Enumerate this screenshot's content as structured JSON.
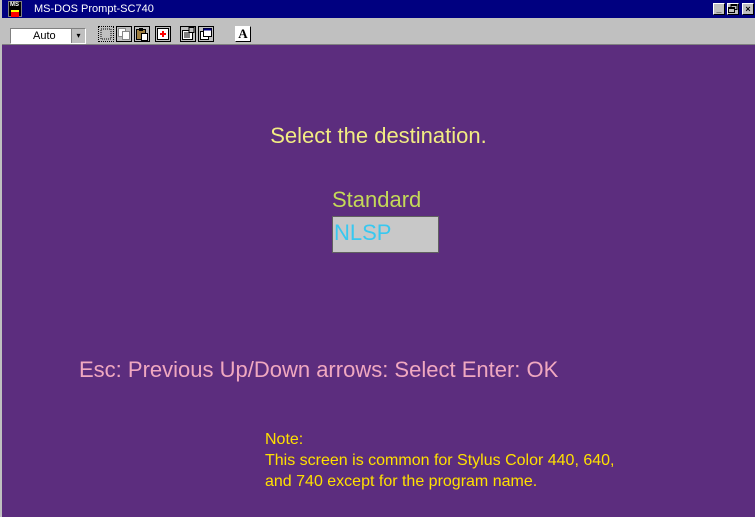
{
  "window": {
    "title": "MS-DOS Prompt-SC740",
    "app_icon_text": "MS",
    "buttons": {
      "minimize": "_",
      "maximize": "F",
      "close": "×"
    }
  },
  "toolbar": {
    "font_size_value": "Auto",
    "dropdown_arrow": "▾",
    "tools": [
      {
        "name": "mark-icon"
      },
      {
        "name": "copy-icon"
      },
      {
        "name": "paste-icon"
      },
      {
        "name": "full-screen-icon"
      },
      {
        "name": "properties-icon"
      },
      {
        "name": "background-icon"
      },
      {
        "name": "font-icon",
        "label": "A"
      }
    ]
  },
  "screen": {
    "heading": "Select the destination.",
    "options": [
      {
        "label": "Standard",
        "selected": false
      },
      {
        "label": "NLSP",
        "selected": true
      }
    ],
    "help_text": "Esc: Previous  Up/Down arrows: Select  Enter: OK",
    "note": {
      "title": "Note:",
      "line1": "This screen is common for Stylus Color 440, 640,",
      "line2": "and 740 except for the program name."
    }
  },
  "colors": {
    "screen_background": "#5c2d7e",
    "heading": "#f2ec82",
    "option_standard": "#c4d958",
    "option_selected_text": "#38c8f0",
    "option_selected_bg": "#c8c8c8",
    "help_text": "#f0a8c0",
    "note_text": "#ffe000",
    "titlebar": "#000080"
  }
}
